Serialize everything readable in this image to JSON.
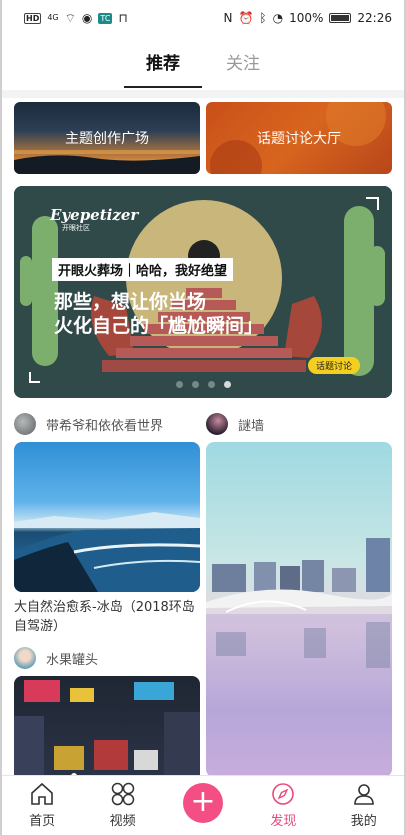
{
  "status_bar": {
    "hd": "HD",
    "network": "4G",
    "app_badge": "TC",
    "battery_pct": "100%",
    "time": "22:26"
  },
  "tabs": [
    {
      "label": "推荐",
      "active": true
    },
    {
      "label": "关注",
      "active": false
    }
  ],
  "categories": [
    {
      "label": "主题创作广场"
    },
    {
      "label": "话题讨论大厅"
    }
  ],
  "banner": {
    "brand": "Eyepetizer",
    "brand_sub": "开眼社区",
    "tag": "开眼火葬场｜哈哈，我好绝望",
    "headline_line1": "那些，想让你当场",
    "headline_line2": "火化自己的「尴尬瞬间」",
    "badge": "话题讨论",
    "dots": 4,
    "active_dot": 3
  },
  "feed": {
    "left": [
      {
        "author": "带希爷和依依看世界",
        "title": "大自然治愈系-冰岛（2018环岛自驾游）",
        "image_icon": "iceland-sea-photo"
      },
      {
        "author": "水果罐头",
        "title": "",
        "image_icon": "city-night-street-photo"
      }
    ],
    "right": [
      {
        "author": "謎墙",
        "title": "",
        "image_icon": "city-bridge-photo"
      }
    ]
  },
  "bottom_nav": [
    {
      "label": "首页",
      "icon": "home-icon",
      "active": false
    },
    {
      "label": "视频",
      "icon": "grid-icon",
      "active": false
    },
    {
      "label": "",
      "icon": "plus-icon",
      "active": false
    },
    {
      "label": "发现",
      "icon": "compass-icon",
      "active": true
    },
    {
      "label": "我的",
      "icon": "user-icon",
      "active": false
    }
  ],
  "colors": {
    "accent": "#f34f84",
    "active_nav": "#e94a7c",
    "banner_badge": "#f4cf21"
  }
}
